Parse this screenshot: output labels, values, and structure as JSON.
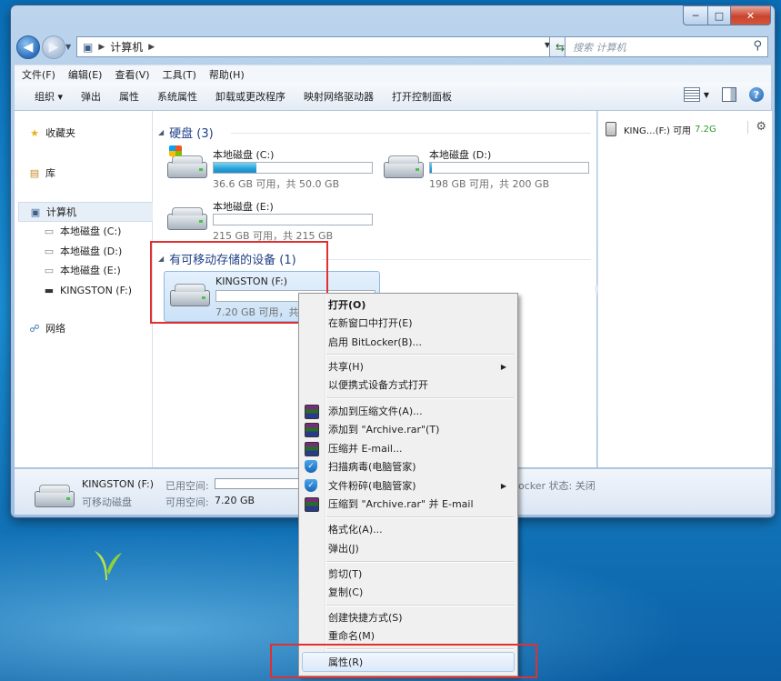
{
  "window": {
    "caption_buttons": {
      "minimize": "─",
      "maximize": "□",
      "close": "✕"
    }
  },
  "address_bar": {
    "crumbs": [
      "计算机"
    ],
    "search_placeholder": "搜索 计算机"
  },
  "menu_bar": [
    "文件(F)",
    "编辑(E)",
    "查看(V)",
    "工具(T)",
    "帮助(H)"
  ],
  "command_bar": {
    "organize": "组织 ▾",
    "items": [
      "弹出",
      "属性",
      "系统属性",
      "卸载或更改程序",
      "映射网络驱动器",
      "打开控制面板"
    ]
  },
  "nav_pane": {
    "favorites": "收藏夹",
    "libraries": "库",
    "computer": "计算机",
    "computer_children": [
      "本地磁盘 (C:)",
      "本地磁盘 (D:)",
      "本地磁盘 (E:)",
      "KINGSTON (F:)"
    ],
    "network": "网络"
  },
  "groups": {
    "hdd": {
      "title": "硬盘 (3)"
    },
    "removable": {
      "title": "有可移动存储的设备 (1)"
    }
  },
  "drives": [
    {
      "name": "本地磁盘 (C:)",
      "free": "36.6 GB 可用，共 50.0 GB",
      "used_fraction": 0.27
    },
    {
      "name": "本地磁盘 (D:)",
      "free": "198 GB 可用，共 200 GB",
      "used_fraction": 0.01
    },
    {
      "name": "本地磁盘 (E:)",
      "free": "215 GB 可用，共 215 GB",
      "used_fraction": 0.0
    },
    {
      "name": "KINGSTON (F:)",
      "free": "7.20 GB 可用，共",
      "used_fraction": 0.0
    }
  ],
  "details_pane": {
    "text": "KING…(F:) 可用",
    "value": "7.2G"
  },
  "status_bar": {
    "name": "KINGSTON (F:)",
    "type": "可移动磁盘",
    "used_label": "已用空间:",
    "free_label": "可用空间:",
    "free_value": "7.20 GB",
    "bitlocker": "ocker 状态: 关闭"
  },
  "context_menu": {
    "open": "打开(O)",
    "open_new_window": "在新窗口中打开(E)",
    "bitlocker": "启用 BitLocker(B)...",
    "share": "共享(H)",
    "portable": "以便携式设备方式打开",
    "add_archive": "添加到压缩文件(A)...",
    "add_archive_rar": "添加到 \"Archive.rar\"(T)",
    "compress_email": "压缩并 E-mail...",
    "scan_virus": "扫描病毒(电脑管家)",
    "shred": "文件粉碎(电脑管家)",
    "compress_rar_email": "压缩到 \"Archive.rar\" 并 E-mail",
    "format": "格式化(A)...",
    "eject": "弹出(J)",
    "cut": "剪切(T)",
    "copy": "复制(C)",
    "create_shortcut": "创建快捷方式(S)",
    "rename": "重命名(M)",
    "properties": "属性(R)"
  }
}
